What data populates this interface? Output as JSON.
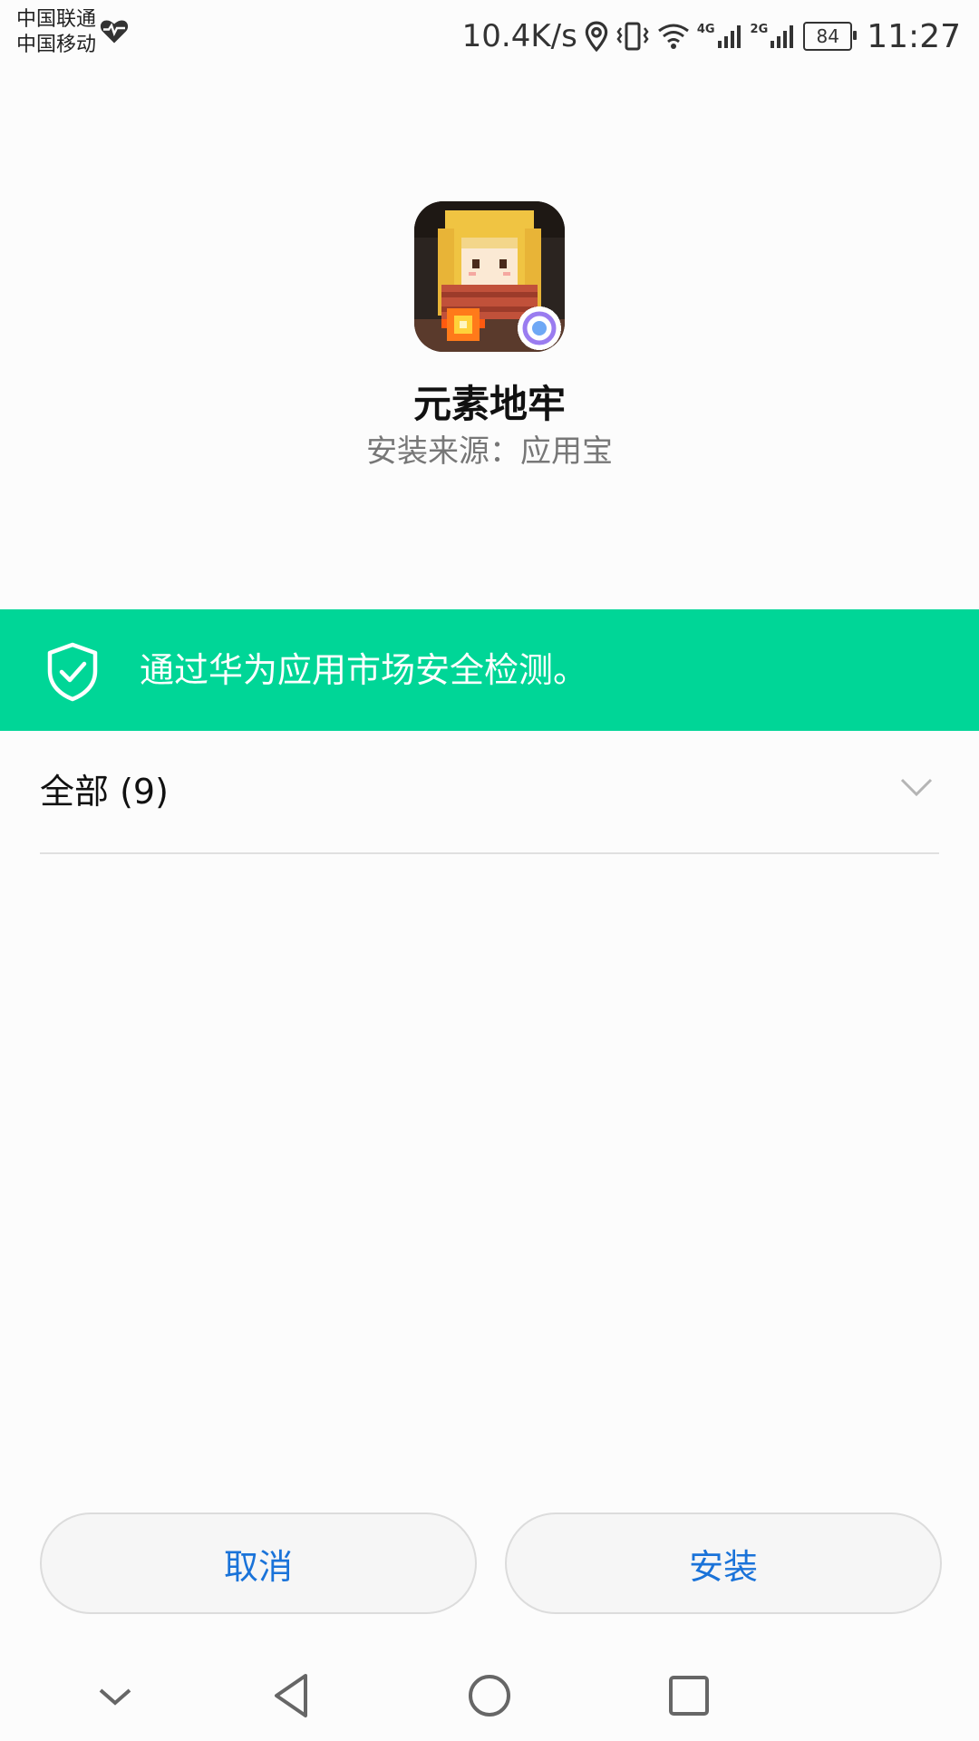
{
  "status_bar": {
    "carrier_1": "中国联通",
    "carrier_2": "中国移动",
    "net_speed": "10.4K/s",
    "signal_1_label": "4G",
    "signal_2_label": "2G",
    "battery": "84",
    "time": "11:27"
  },
  "app": {
    "name": "元素地牢",
    "install_source": "安装来源：应用宝"
  },
  "security": {
    "message": "通过华为应用市场安全检测。",
    "color": "#00d697"
  },
  "permissions": {
    "label": "全部 (9)"
  },
  "buttons": {
    "cancel": "取消",
    "install": "安装",
    "accent": "#1a73d9"
  },
  "nav": {
    "icons": [
      "chevron-down-icon",
      "back-icon",
      "home-icon",
      "recents-icon"
    ]
  }
}
